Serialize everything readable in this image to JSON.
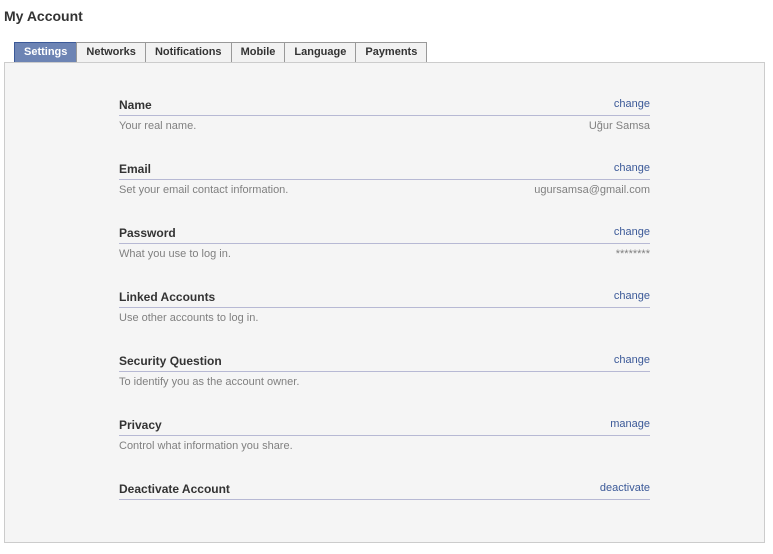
{
  "page": {
    "title": "My Account"
  },
  "tabs": [
    {
      "label": "Settings",
      "active": true
    },
    {
      "label": "Networks",
      "active": false
    },
    {
      "label": "Notifications",
      "active": false
    },
    {
      "label": "Mobile",
      "active": false
    },
    {
      "label": "Language",
      "active": false
    },
    {
      "label": "Payments",
      "active": false
    }
  ],
  "sections": [
    {
      "title": "Name",
      "action": "change",
      "description": "Your real name.",
      "value": "Uğur Samsa"
    },
    {
      "title": "Email",
      "action": "change",
      "description": "Set your email contact information.",
      "value": "ugursamsa@gmail.com"
    },
    {
      "title": "Password",
      "action": "change",
      "description": "What you use to log in.",
      "value": "********"
    },
    {
      "title": "Linked Accounts",
      "action": "change",
      "description": "Use other accounts to log in.",
      "value": ""
    },
    {
      "title": "Security Question",
      "action": "change",
      "description": "To identify you as the account owner.",
      "value": ""
    },
    {
      "title": "Privacy",
      "action": "manage",
      "description": "Control what information you share.",
      "value": ""
    },
    {
      "title": "Deactivate Account",
      "action": "deactivate",
      "description": "",
      "value": ""
    }
  ],
  "colors": {
    "accent": "#3b5998",
    "active_tab": "#6d84b4",
    "rule": "#b7b9d4"
  }
}
